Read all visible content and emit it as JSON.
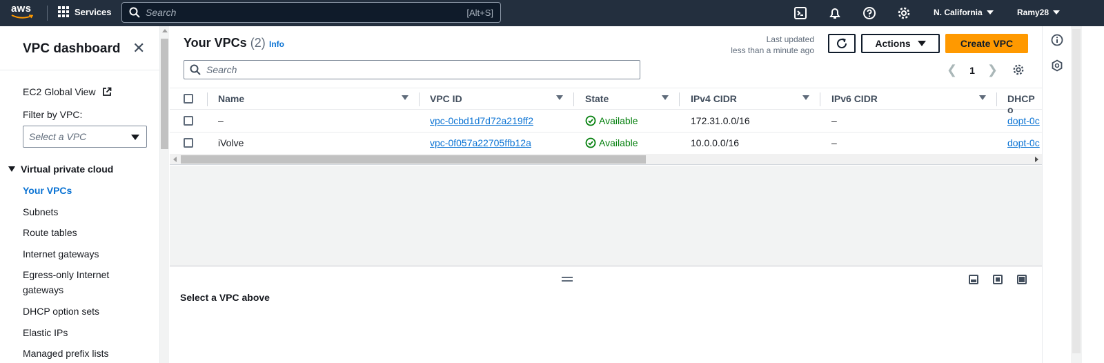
{
  "topnav": {
    "logo": "aws",
    "services_label": "Services",
    "search_placeholder": "Search",
    "search_shortcut": "[Alt+S]",
    "region": "N. California",
    "user": "Ramy28"
  },
  "sidebar": {
    "title": "VPC dashboard",
    "ec2_global_view": "EC2 Global View",
    "filter_label": "Filter by VPC:",
    "filter_placeholder": "Select a VPC",
    "section": "Virtual private cloud",
    "items": [
      {
        "label": "Your VPCs",
        "active": true
      },
      {
        "label": "Subnets"
      },
      {
        "label": "Route tables"
      },
      {
        "label": "Internet gateways"
      },
      {
        "label": "Egress-only Internet gateways"
      },
      {
        "label": "DHCP option sets"
      },
      {
        "label": "Elastic IPs"
      },
      {
        "label": "Managed prefix lists"
      }
    ]
  },
  "main": {
    "title": "Your VPCs",
    "count": "(2)",
    "info": "Info",
    "last_updated_label": "Last updated",
    "last_updated_value": "less than a minute ago",
    "actions_label": "Actions",
    "create_label": "Create VPC",
    "search_placeholder": "Search",
    "page_number": "1",
    "columns": [
      "Name",
      "VPC ID",
      "State",
      "IPv4 CIDR",
      "IPv6 CIDR",
      "DHCP o"
    ],
    "rows": [
      {
        "name": "–",
        "vpc_id": "vpc-0cbd1d7d72a219ff2",
        "state": "Available",
        "ipv4": "172.31.0.0/16",
        "ipv6": "–",
        "dhcp": "dopt-0c"
      },
      {
        "name": "iVolve",
        "vpc_id": "vpc-0f057a22705ffb12a",
        "state": "Available",
        "ipv4": "10.0.0.0/16",
        "ipv6": "–",
        "dhcp": "dopt-0c"
      }
    ],
    "split_message": "Select a VPC above"
  },
  "colors": {
    "nav_bg": "#232f3e",
    "link": "#0972d3",
    "primary_button": "#ff9900",
    "status_ok": "#037f0c"
  }
}
